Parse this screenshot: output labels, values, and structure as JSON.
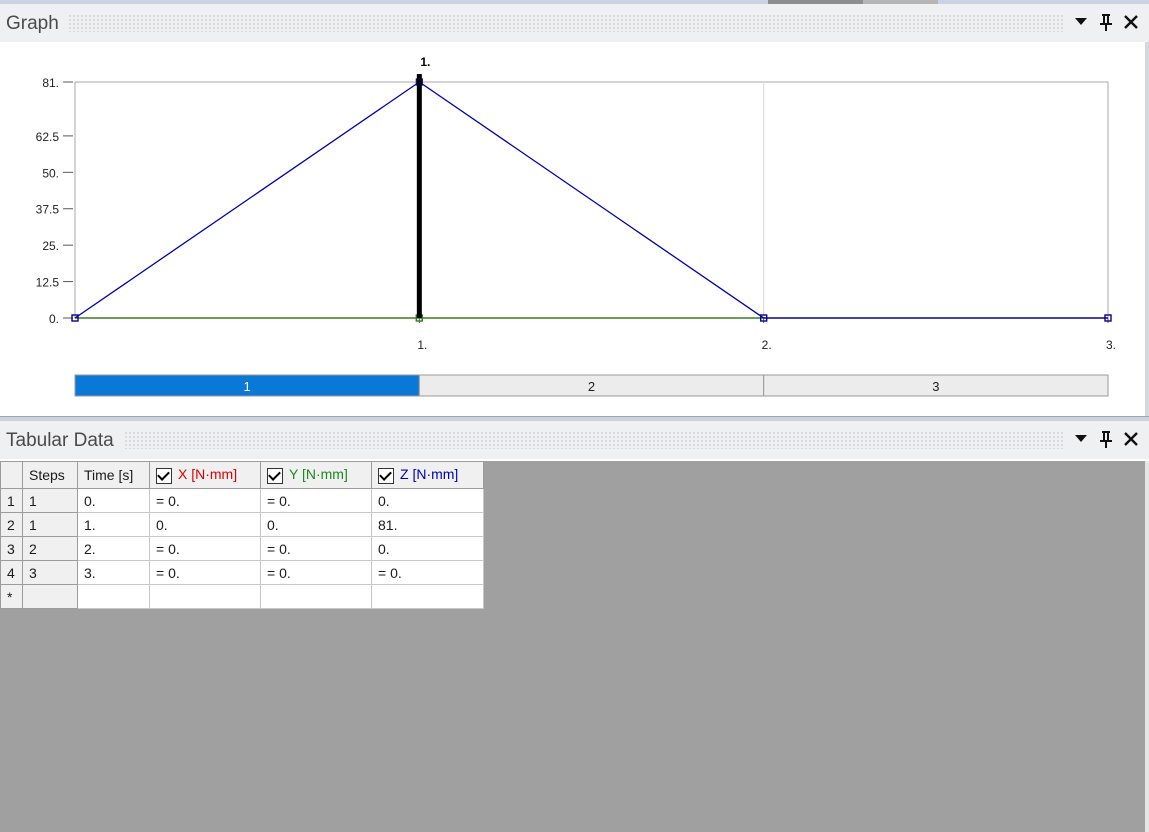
{
  "graph_panel": {
    "title": "Graph"
  },
  "tabular_panel": {
    "title": "Tabular Data"
  },
  "chart_data": {
    "type": "line",
    "title": "",
    "xlabel": "",
    "ylabel": "",
    "xlim": [
      0,
      3
    ],
    "ylim": [
      0,
      81
    ],
    "x_tick_labels": [
      {
        "value": 1,
        "label": "1."
      },
      {
        "value": 2,
        "label": "2."
      },
      {
        "value": 3,
        "label": "3."
      }
    ],
    "y_tick_labels": [
      {
        "value": 0,
        "label": "0."
      },
      {
        "value": 12.5,
        "label": "12.5"
      },
      {
        "value": 25,
        "label": "25."
      },
      {
        "value": 37.5,
        "label": "37.5"
      },
      {
        "value": 50,
        "label": "50."
      },
      {
        "value": 62.5,
        "label": "62.5"
      },
      {
        "value": 81,
        "label": "81."
      }
    ],
    "current_time": 1,
    "current_time_label": "1.",
    "series": [
      {
        "name": "X [N·mm]",
        "color": "#e00000",
        "points": [
          [
            0,
            0
          ],
          [
            1,
            0
          ],
          [
            2,
            0
          ],
          [
            3,
            0
          ]
        ]
      },
      {
        "name": "Y [N·mm]",
        "color": "#1a8a1a",
        "points": [
          [
            0,
            0
          ],
          [
            1,
            0
          ],
          [
            2,
            0
          ],
          [
            3,
            0
          ]
        ]
      },
      {
        "name": "Z [N·mm]",
        "color": "#0000b0",
        "points": [
          [
            0,
            0
          ],
          [
            1,
            81
          ],
          [
            2,
            0
          ],
          [
            3,
            0
          ]
        ]
      }
    ],
    "steps_bar": [
      {
        "label": "1",
        "from": 0,
        "to": 1,
        "active": true
      },
      {
        "label": "2",
        "from": 1,
        "to": 2,
        "active": false
      },
      {
        "label": "3",
        "from": 2,
        "to": 3,
        "active": false
      }
    ]
  },
  "table": {
    "headers": {
      "steps": "Steps",
      "time": "Time [s]",
      "x": "X [N·mm]",
      "y": "Y [N·mm]",
      "z": "Z [N·mm]"
    },
    "header_colors": {
      "x": "#e00000",
      "y": "#1a8a1a",
      "z": "#0000b0"
    },
    "rows": [
      {
        "num": "1",
        "steps": "1",
        "time": "0.",
        "x": "= 0.",
        "y": "= 0.",
        "z": "0."
      },
      {
        "num": "2",
        "steps": "1",
        "time": "1.",
        "x": "0.",
        "y": "0.",
        "z": "81."
      },
      {
        "num": "3",
        "steps": "2",
        "time": "2.",
        "x": "= 0.",
        "y": "= 0.",
        "z": "0."
      },
      {
        "num": "4",
        "steps": "3",
        "time": "3.",
        "x": "= 0.",
        "y": "= 0.",
        "z": "= 0."
      }
    ],
    "new_row_marker": "*"
  }
}
